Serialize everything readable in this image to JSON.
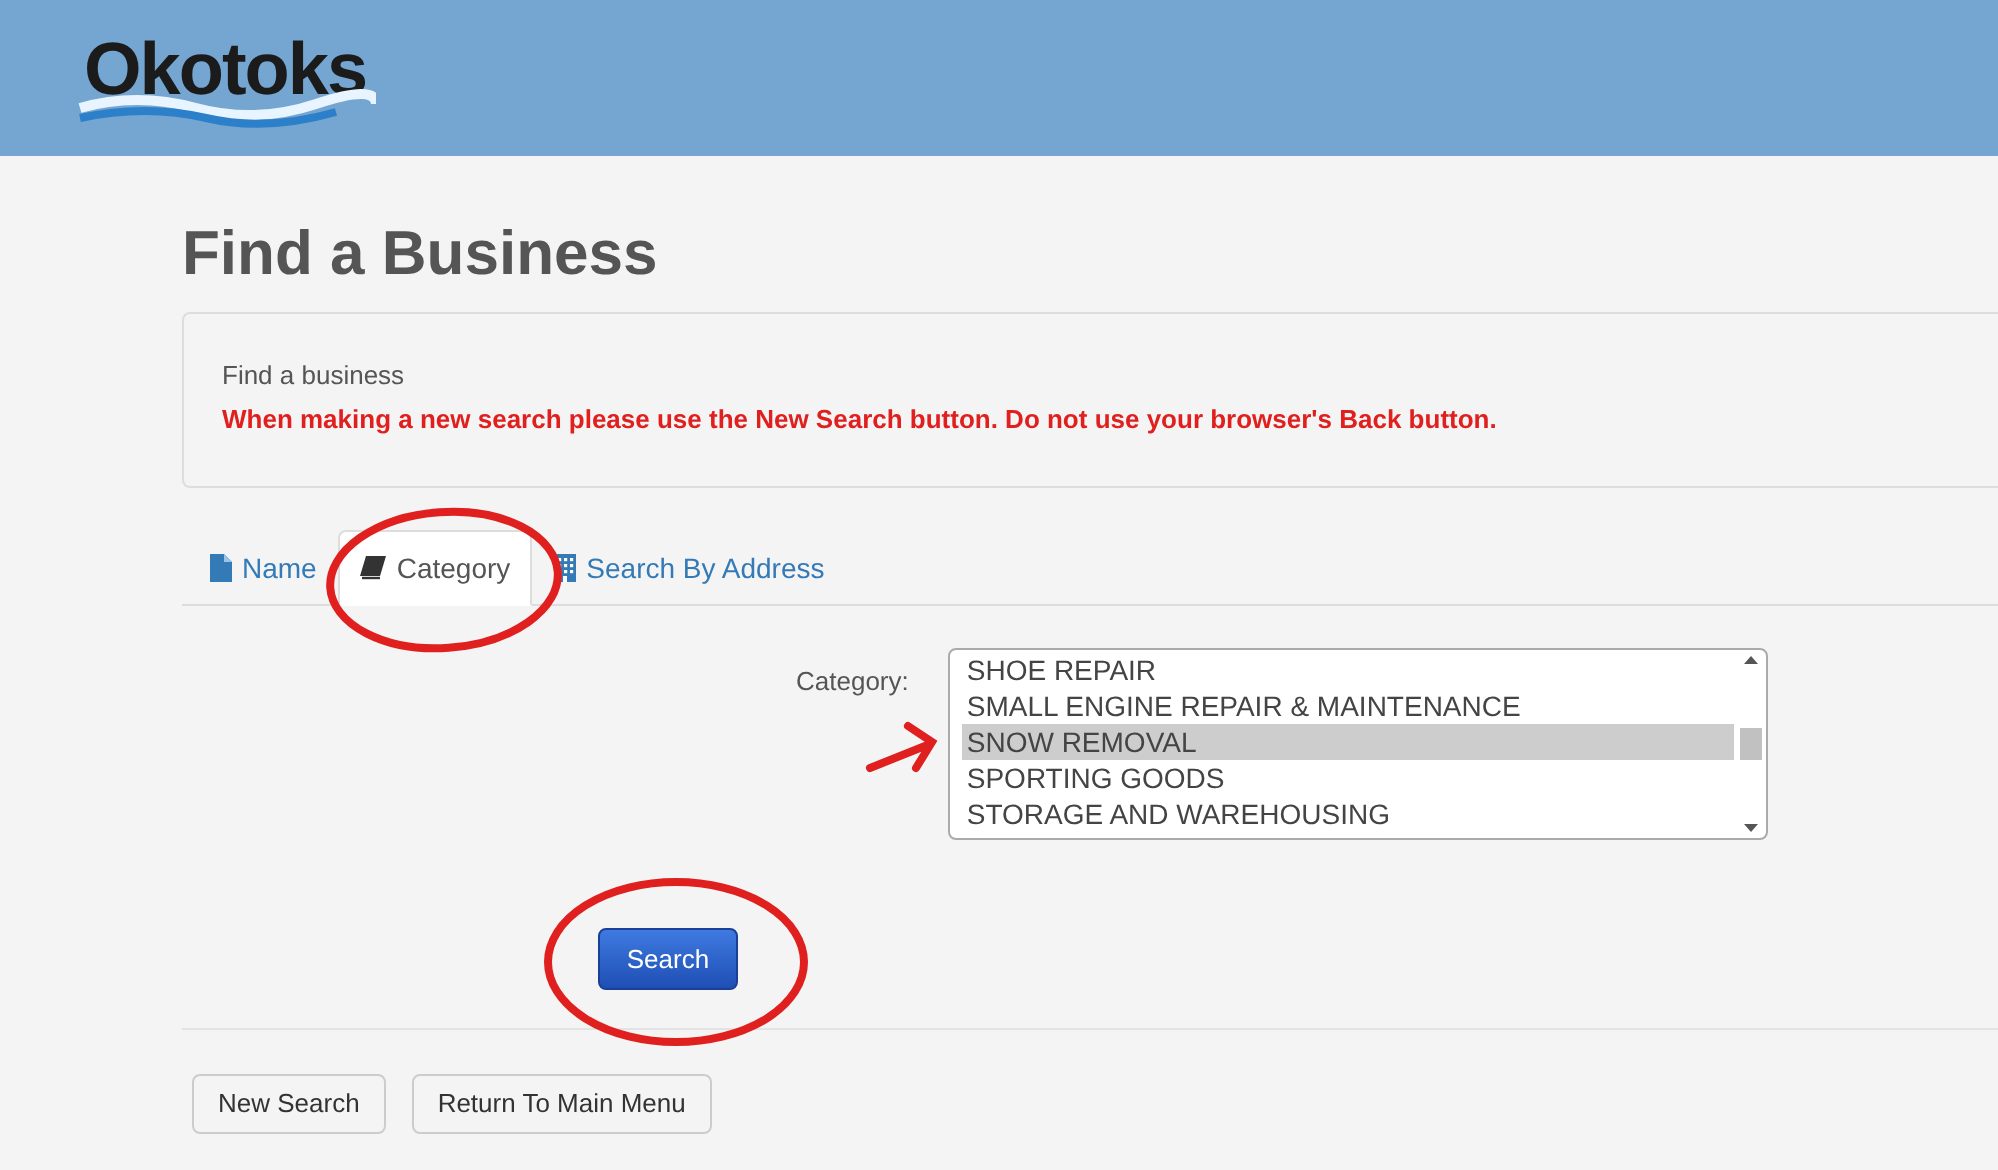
{
  "header": {
    "logo_text": "Okotoks"
  },
  "page_title": "Find a Business",
  "info_panel": {
    "heading": "Find a business",
    "warning": "When making a new search please use the New Search button. Do not use your browser's Back button."
  },
  "tabs": [
    {
      "label": "Name",
      "kind": "file",
      "selected": false
    },
    {
      "label": "Category",
      "kind": "book",
      "selected": true
    },
    {
      "label": "Search By Address",
      "kind": "building",
      "selected": false
    }
  ],
  "category_field": {
    "label": "Category:",
    "options": [
      {
        "label": "SHOE REPAIR",
        "selected": false
      },
      {
        "label": "SMALL ENGINE REPAIR & MAINTENANCE",
        "selected": false
      },
      {
        "label": "SNOW REMOVAL",
        "selected": true
      },
      {
        "label": "SPORTING GOODS",
        "selected": false
      },
      {
        "label": "STORAGE AND WAREHOUSING",
        "selected": false
      }
    ]
  },
  "search_button": "Search",
  "footer_buttons": [
    "New Search",
    "Return To Main Menu"
  ]
}
